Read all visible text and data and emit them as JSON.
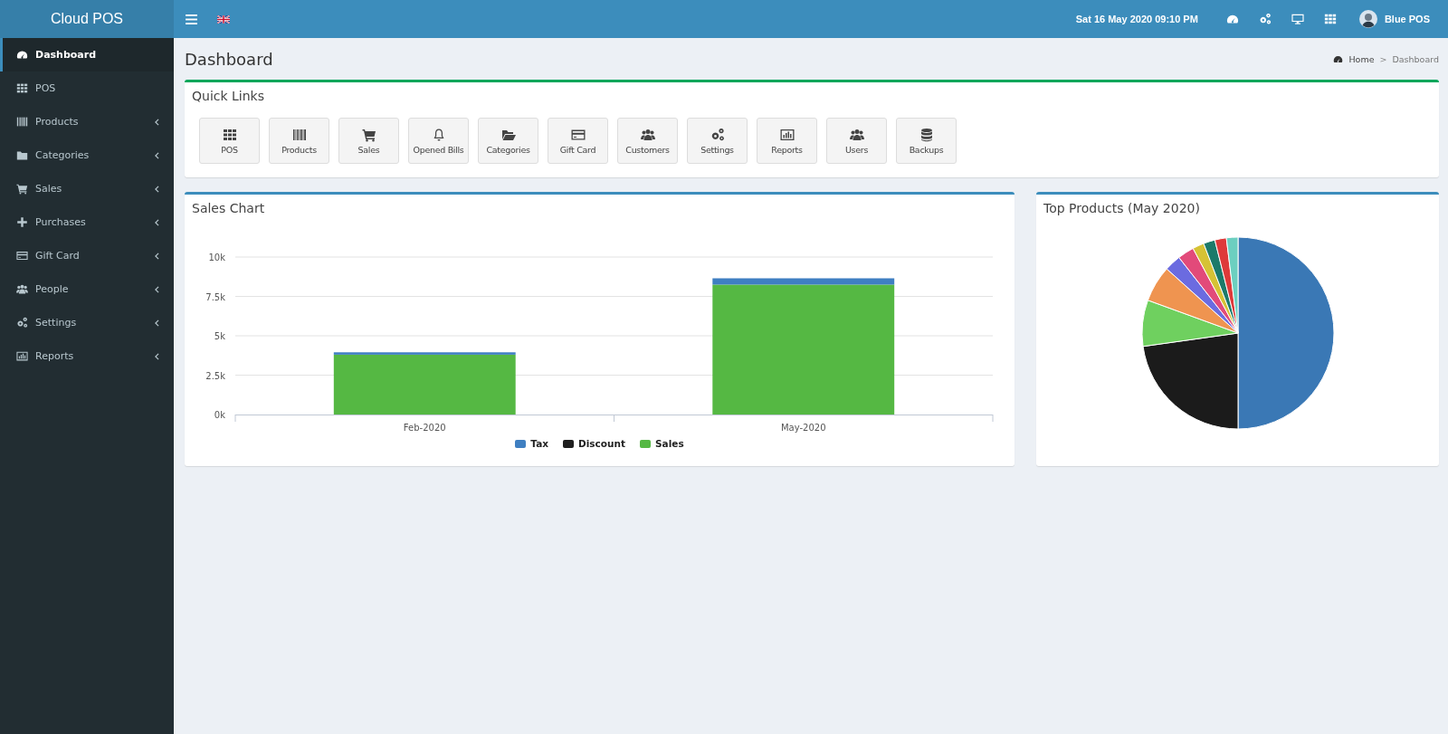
{
  "header": {
    "logo": "Cloud POS",
    "datetime": "Sat 16 May 2020 09:10 PM",
    "user": "Blue POS"
  },
  "sidebar": {
    "items": [
      {
        "label": "Dashboard",
        "selected": true,
        "expandable": false
      },
      {
        "label": "POS",
        "selected": false,
        "expandable": false
      },
      {
        "label": "Products",
        "selected": false,
        "expandable": true
      },
      {
        "label": "Categories",
        "selected": false,
        "expandable": true
      },
      {
        "label": "Sales",
        "selected": false,
        "expandable": true
      },
      {
        "label": "Purchases",
        "selected": false,
        "expandable": true
      },
      {
        "label": "Gift Card",
        "selected": false,
        "expandable": true
      },
      {
        "label": "People",
        "selected": false,
        "expandable": true
      },
      {
        "label": "Settings",
        "selected": false,
        "expandable": true
      },
      {
        "label": "Reports",
        "selected": false,
        "expandable": true
      }
    ]
  },
  "page": {
    "title": "Dashboard",
    "breadcrumb": {
      "home": "Home",
      "separator": ">",
      "current": "Dashboard"
    }
  },
  "quick_links": {
    "title": "Quick Links",
    "items": [
      "POS",
      "Products",
      "Sales",
      "Opened Bills",
      "Categories",
      "Gift Card",
      "Customers",
      "Settings",
      "Reports",
      "Users",
      "Backups"
    ]
  },
  "sales_chart": {
    "title": "Sales Chart",
    "chart_data": {
      "type": "bar",
      "stacked": true,
      "grid": true,
      "categories": [
        "Feb-2020",
        "May-2020"
      ],
      "series": [
        {
          "name": "Tax",
          "color": "#3f7fc1",
          "values": [
            150,
            400
          ]
        },
        {
          "name": "Discount",
          "color": "#1f1f1f",
          "values": [
            0,
            0
          ]
        },
        {
          "name": "Sales",
          "color": "#55b843",
          "values": [
            3800,
            8250
          ]
        }
      ],
      "ylim": [
        0,
        10000
      ],
      "yticks": [
        {
          "value": 0,
          "label": "0k"
        },
        {
          "value": 2500,
          "label": "2.5k"
        },
        {
          "value": 5000,
          "label": "5k"
        },
        {
          "value": 7500,
          "label": "7.5k"
        },
        {
          "value": 10000,
          "label": "10k"
        }
      ]
    }
  },
  "top_products": {
    "title": "Top Products (May 2020)"
  }
}
